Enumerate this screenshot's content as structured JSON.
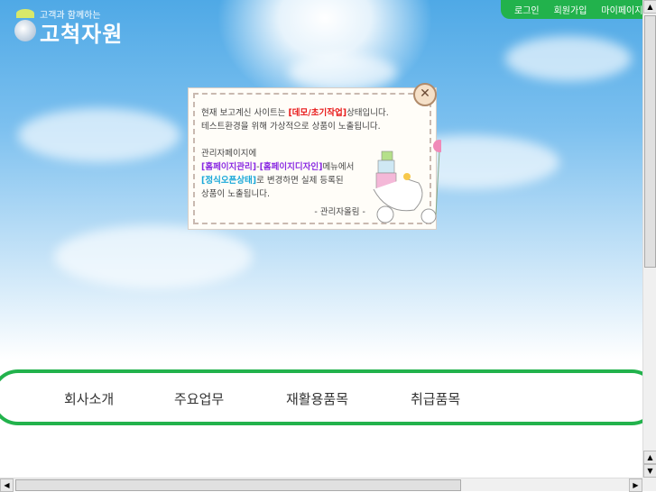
{
  "logo": {
    "tagline": "고객과 함께하는",
    "name": "고척자원"
  },
  "topnav": [
    "로그인",
    "회원가입",
    "마이페이지"
  ],
  "popup": {
    "line1_pre": "현재 보고계신 사이트는 ",
    "line1_hl": "[데모/초기작업]",
    "line1_post": "상태입니다.",
    "line2": "테스트환경을 위해 가상적으로 상품이 노출됩니다.",
    "line3": "관리자페이지에",
    "line4_hl1": "[홈페이지관리]",
    "line4_sep": "-",
    "line4_hl2": "[홈페이지디자인]",
    "line4_post": "메뉴에서",
    "line5_hl": "[정식오픈상태]",
    "line5_post": "로 변경하면 실제 등록된",
    "line6": "상품이 노출됩니다.",
    "sign": "- 관리자올림 -",
    "close": "✕"
  },
  "menu": [
    "회사소개",
    "주요업무",
    "재활용품목",
    "취급품목"
  ],
  "colors": {
    "green": "#22b24c",
    "sky": "#4fa9e6"
  }
}
